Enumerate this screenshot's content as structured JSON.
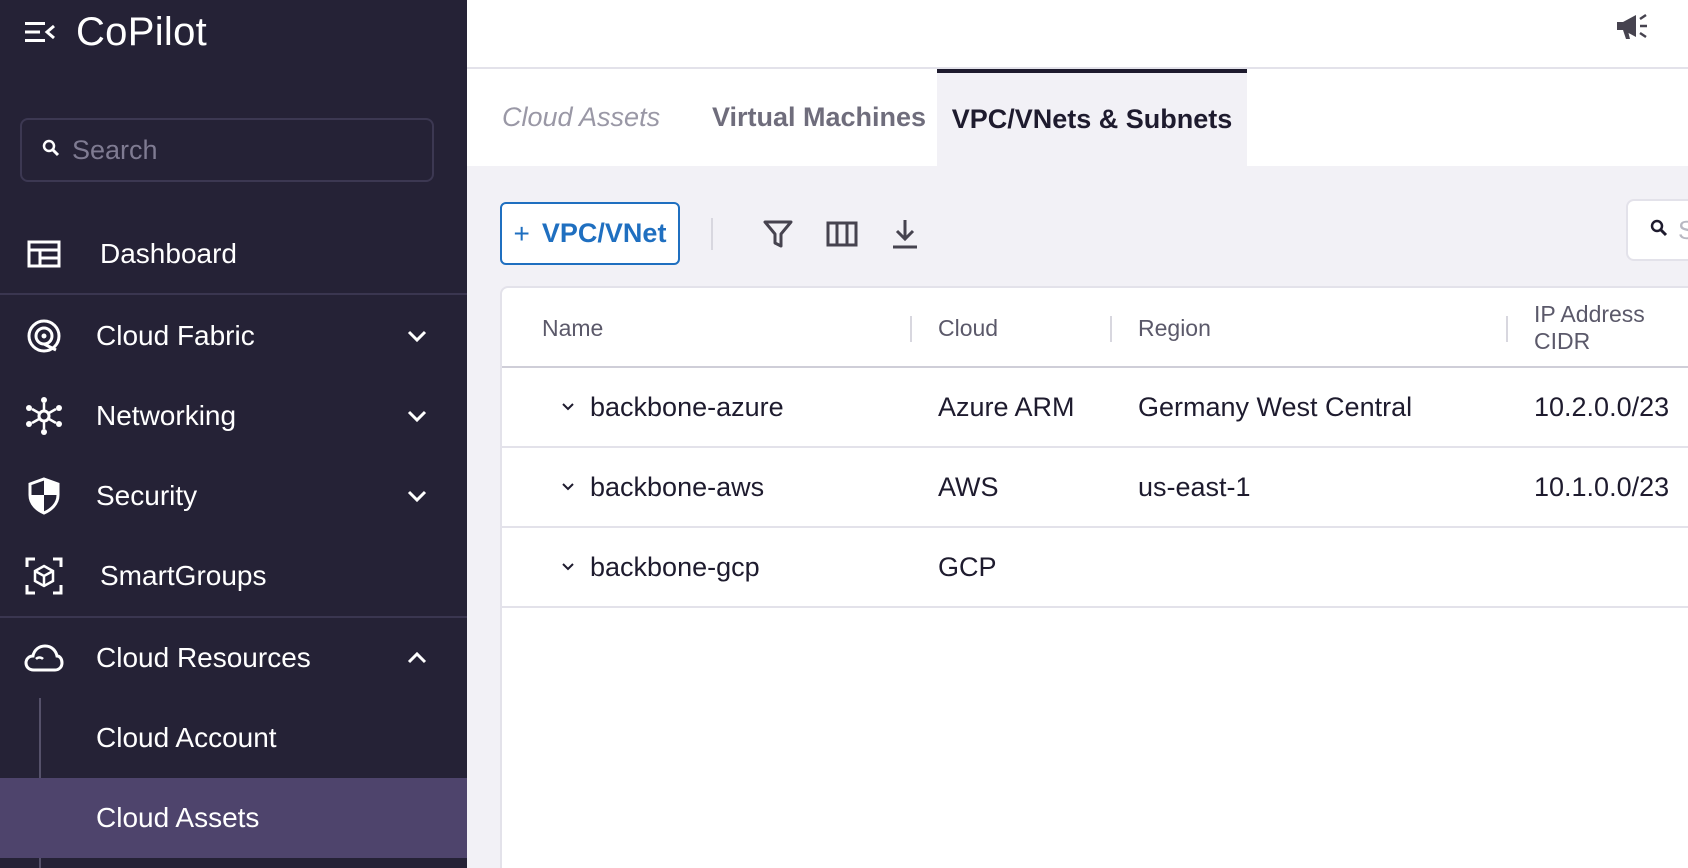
{
  "app": {
    "title": "CoPilot"
  },
  "sidebar": {
    "search_placeholder": "Search",
    "items": [
      {
        "label": "Dashboard",
        "icon": "dashboard-icon",
        "expandable": false
      },
      {
        "label": "Cloud Fabric",
        "icon": "cloud-fabric-icon",
        "expandable": true,
        "expanded": false
      },
      {
        "label": "Networking",
        "icon": "networking-icon",
        "expandable": true,
        "expanded": false
      },
      {
        "label": "Security",
        "icon": "shield-icon",
        "expandable": true,
        "expanded": false
      },
      {
        "label": "SmartGroups",
        "icon": "smartgroups-icon",
        "expandable": false
      },
      {
        "label": "Cloud Resources",
        "icon": "cloud-icon",
        "expandable": true,
        "expanded": true
      }
    ],
    "subitems": [
      {
        "label": "Cloud Account",
        "active": false
      },
      {
        "label": "Cloud Assets",
        "active": true
      }
    ]
  },
  "tabs": {
    "breadcrumb": "Cloud Assets",
    "items": [
      {
        "label": "Virtual Machines",
        "active": false
      },
      {
        "label": "VPC/VNets & Subnets",
        "active": true
      }
    ]
  },
  "toolbar": {
    "add_label": "VPC/VNet",
    "add_icon": "plus-icon",
    "tools": [
      "filter-icon",
      "columns-icon",
      "download-icon"
    ],
    "search_placeholder": "Search"
  },
  "table": {
    "columns": [
      "Name",
      "Cloud",
      "Region",
      "IP Address CIDR"
    ],
    "rows": [
      {
        "name": "backbone-azure",
        "cloud": "Azure ARM",
        "region": "Germany West Central",
        "cidr": "10.2.0.0/23"
      },
      {
        "name": "backbone-aws",
        "cloud": "AWS",
        "region": "us-east-1",
        "cidr": "10.1.0.0/23"
      },
      {
        "name": "backbone-gcp",
        "cloud": "GCP",
        "region": "",
        "cidr": ""
      }
    ]
  },
  "colors": {
    "sidebar_bg": "#252236",
    "sidebar_active": "#4e446c",
    "accent_blue": "#1f6fc0",
    "content_bg": "#f2f1f6"
  }
}
